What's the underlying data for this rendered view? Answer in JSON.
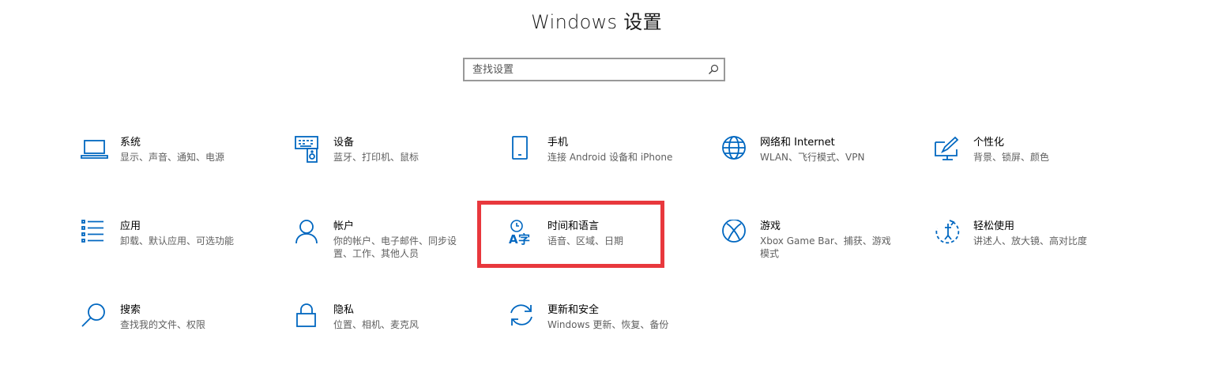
{
  "window": {
    "title": "Windows 设置"
  },
  "search": {
    "placeholder": "查找设置",
    "icon": "search-icon"
  },
  "accent_color": "#0067c0",
  "highlight_color": "#e8383d",
  "tiles": [
    {
      "name": "系统",
      "desc": "显示、声音、通知、电源",
      "icon": "laptop-icon"
    },
    {
      "name": "设备",
      "desc": "蓝牙、打印机、鼠标",
      "icon": "devices-icon"
    },
    {
      "name": "手机",
      "desc": "连接 Android 设备和 iPhone",
      "icon": "phone-icon"
    },
    {
      "name": "网络和 Internet",
      "desc": "WLAN、飞行模式、VPN",
      "icon": "globe-icon"
    },
    {
      "name": "个性化",
      "desc": "背景、锁屏、颜色",
      "icon": "personalization-icon"
    },
    {
      "name": "应用",
      "desc": "卸载、默认应用、可选功能",
      "icon": "apps-list-icon"
    },
    {
      "name": "帐户",
      "desc": "你的帐户、电子邮件、同步设置、工作、其他人员",
      "icon": "person-icon"
    },
    {
      "name": "时间和语言",
      "desc": "语音、区域、日期",
      "icon": "time-language-icon",
      "highlighted": true
    },
    {
      "name": "游戏",
      "desc": "Xbox Game Bar、捕获、游戏模式",
      "icon": "xbox-icon"
    },
    {
      "name": "轻松使用",
      "desc": "讲述人、放大镜、高对比度",
      "icon": "ease-of-access-icon"
    },
    {
      "name": "搜索",
      "desc": "查找我的文件、权限",
      "icon": "search-magnifier-icon"
    },
    {
      "name": "隐私",
      "desc": "位置、相机、麦克风",
      "icon": "lock-icon"
    },
    {
      "name": "更新和安全",
      "desc": "Windows 更新、恢复、备份",
      "icon": "sync-icon"
    }
  ]
}
